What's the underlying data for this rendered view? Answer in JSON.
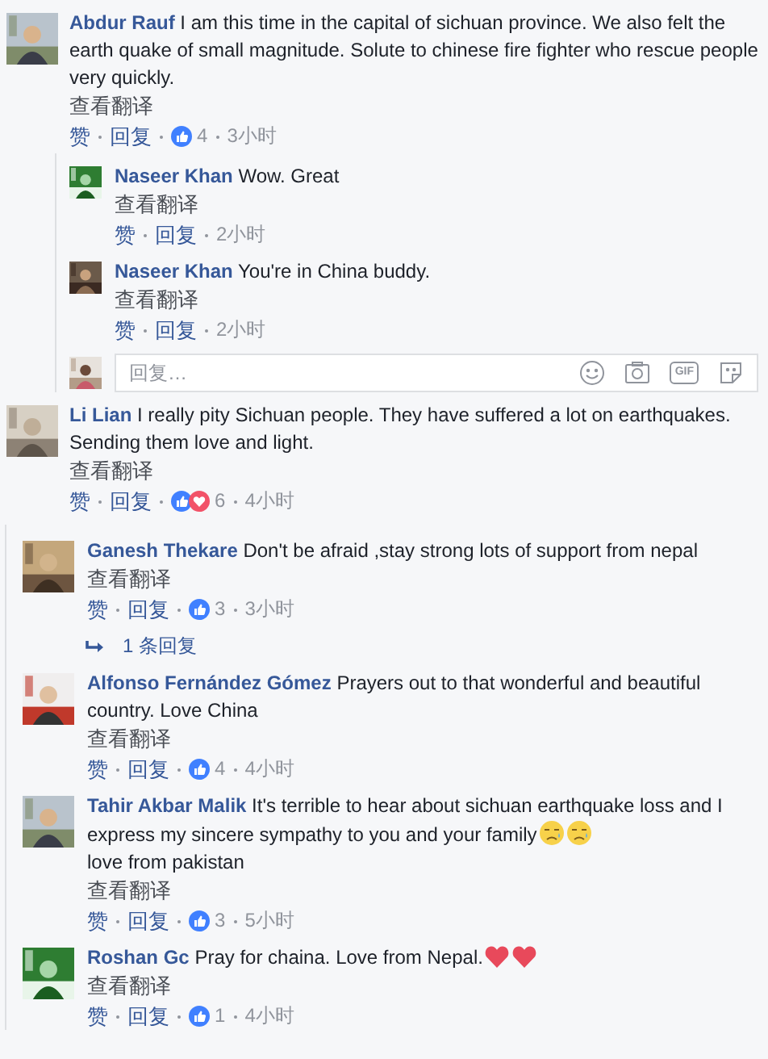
{
  "sections": [
    {
      "bordered": false,
      "comments": [
        {
          "author": "Abdur Rauf",
          "text": "I am this time in the capital of sichuan province. We also felt the earth quake of small magnitude. Solute to chinese fire fighter who rescue people very quickly.",
          "translate": "查看翻译",
          "like": "赞",
          "reply": "回复",
          "reactions": [
            {
              "kind": "like"
            }
          ],
          "reaction_count": "4",
          "time": "3小时",
          "replies": [
            {
              "author": "Naseer Khan",
              "text": "Wow. Great",
              "translate": "查看翻译",
              "like": "赞",
              "reply": "回复",
              "time": "2小时"
            },
            {
              "author": "Naseer Khan",
              "text": "You're in China buddy.",
              "translate": "查看翻译",
              "like": "赞",
              "reply": "回复",
              "time": "2小时"
            }
          ],
          "reply_box": {
            "placeholder": "回复…",
            "gif": "GIF"
          }
        },
        {
          "author": "Li Lian",
          "text": "I really pity Sichuan people. They have suffered a lot on earthquakes. Sending them love and light.",
          "translate": "查看翻译",
          "like": "赞",
          "reply": "回复",
          "reactions": [
            {
              "kind": "like"
            },
            {
              "kind": "love"
            }
          ],
          "reaction_count": "6",
          "time": "4小时"
        }
      ]
    },
    {
      "bordered": true,
      "comments": [
        {
          "author": "Ganesh Thekare",
          "text": "Don't be afraid ,stay strong lots of support from nepal",
          "translate": "查看翻译",
          "like": "赞",
          "reply": "回复",
          "reactions": [
            {
              "kind": "like"
            }
          ],
          "reaction_count": "3",
          "time": "3小时",
          "replies_link": "1 条回复"
        },
        {
          "author": "Alfonso Fernández Gómez",
          "text": "Prayers out to that wonderful and beautiful country. Love China",
          "translate": "查看翻译",
          "like": "赞",
          "reply": "回复",
          "reactions": [
            {
              "kind": "like"
            }
          ],
          "reaction_count": "4",
          "time": "4小时"
        },
        {
          "author": "Tahir Akbar Malik",
          "text": "It's terrible to hear about sichuan earthquake loss and I express my sincere sympathy to you and your family",
          "emoji": [
            {
              "kind": "sad"
            },
            {
              "kind": "sad"
            }
          ],
          "text_after": "love from pakistan",
          "translate": "查看翻译",
          "like": "赞",
          "reply": "回复",
          "reactions": [
            {
              "kind": "like"
            }
          ],
          "reaction_count": "3",
          "time": "5小时"
        },
        {
          "author": "Roshan Gc",
          "text": "Pray for chaina. Love from Nepal.",
          "emoji": [
            {
              "kind": "heart"
            },
            {
              "kind": "heart"
            }
          ],
          "translate": "查看翻译",
          "like": "赞",
          "reply": "回复",
          "reactions": [
            {
              "kind": "like"
            }
          ],
          "reaction_count": "1",
          "time": "4小时"
        }
      ]
    }
  ]
}
